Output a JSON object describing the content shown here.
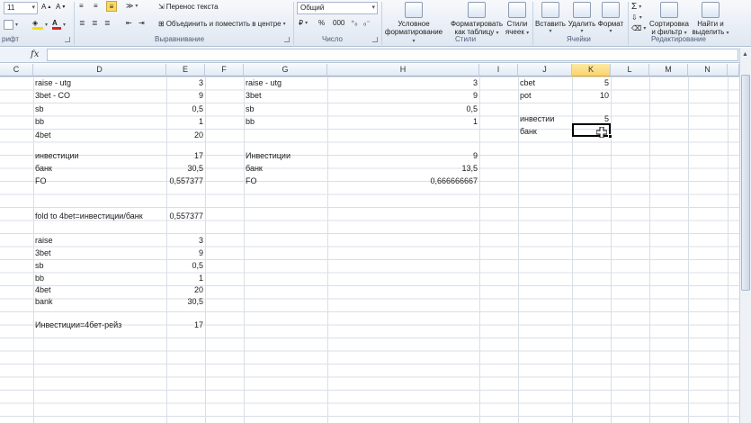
{
  "ribbon": {
    "font_group_label": "рифт",
    "font_size": "11",
    "wrap_text": "Перенос текста",
    "merge_center": "Объединить и поместить в центре",
    "alignment_label": "Выравнивание",
    "number_format": "Общий",
    "percent": "%",
    "thousands": "000",
    "number_label": "Число",
    "cond_format_1": "Условное",
    "cond_format_2": "форматирование",
    "format_table_1": "Форматировать",
    "format_table_2": "как таблицу",
    "cell_styles_1": "Стили",
    "cell_styles_2": "ячеек",
    "styles_label": "Стили",
    "insert": "Вставить",
    "delete": "Удалить",
    "format": "Формат",
    "cells_label": "Ячейки",
    "sort_1": "Сортировка",
    "sort_2": "и фильтр",
    "find_1": "Найти и",
    "find_2": "выделить",
    "editing_label": "Редактирование",
    "fx": "fx"
  },
  "columns": [
    "C",
    "D",
    "E",
    "F",
    "G",
    "H",
    "I",
    "J",
    "K",
    "L",
    "M",
    "N"
  ],
  "active_column": "K",
  "cells": {
    "d1": "raise - utg",
    "e1": "3",
    "d2": "3bet - CO",
    "e2": "9",
    "d3": "sb",
    "e3": "0,5",
    "d4": "bb",
    "e4": "1",
    "d5": "4bet",
    "e5": "20",
    "d7": "инвестиции",
    "e7": "17",
    "d8": "банк",
    "e8": "30,5",
    "d9": "FO",
    "e9": "0,557377",
    "d12": "fold to 4bet=инвестиции/банк",
    "e12": "0,557377",
    "d14": "raise",
    "e14": "3",
    "d15": "3bet",
    "e15": "9",
    "d16": "sb",
    "e16": "0,5",
    "d17": "bb",
    "e17": "1",
    "d18": "4bet",
    "e18": "20",
    "d19": "bank",
    "e19": "30,5",
    "d21": "Инвестиции=4бет-рейз",
    "e21": "17",
    "g1": "raise - utg",
    "h1": "3",
    "g2": "3bet",
    "h2": "9",
    "g3": "sb",
    "h3": "0,5",
    "g4": "bb",
    "h4": "1",
    "g7": "Инвестиции",
    "h7": "9",
    "g8": "банк",
    "h8": "13,5",
    "g9": "FO",
    "h9": "0,666666667",
    "j1": "cbet",
    "k1": "5",
    "j2": "pot",
    "k2": "10",
    "j4": "инвестии",
    "k4": "5",
    "j5": "банк"
  }
}
